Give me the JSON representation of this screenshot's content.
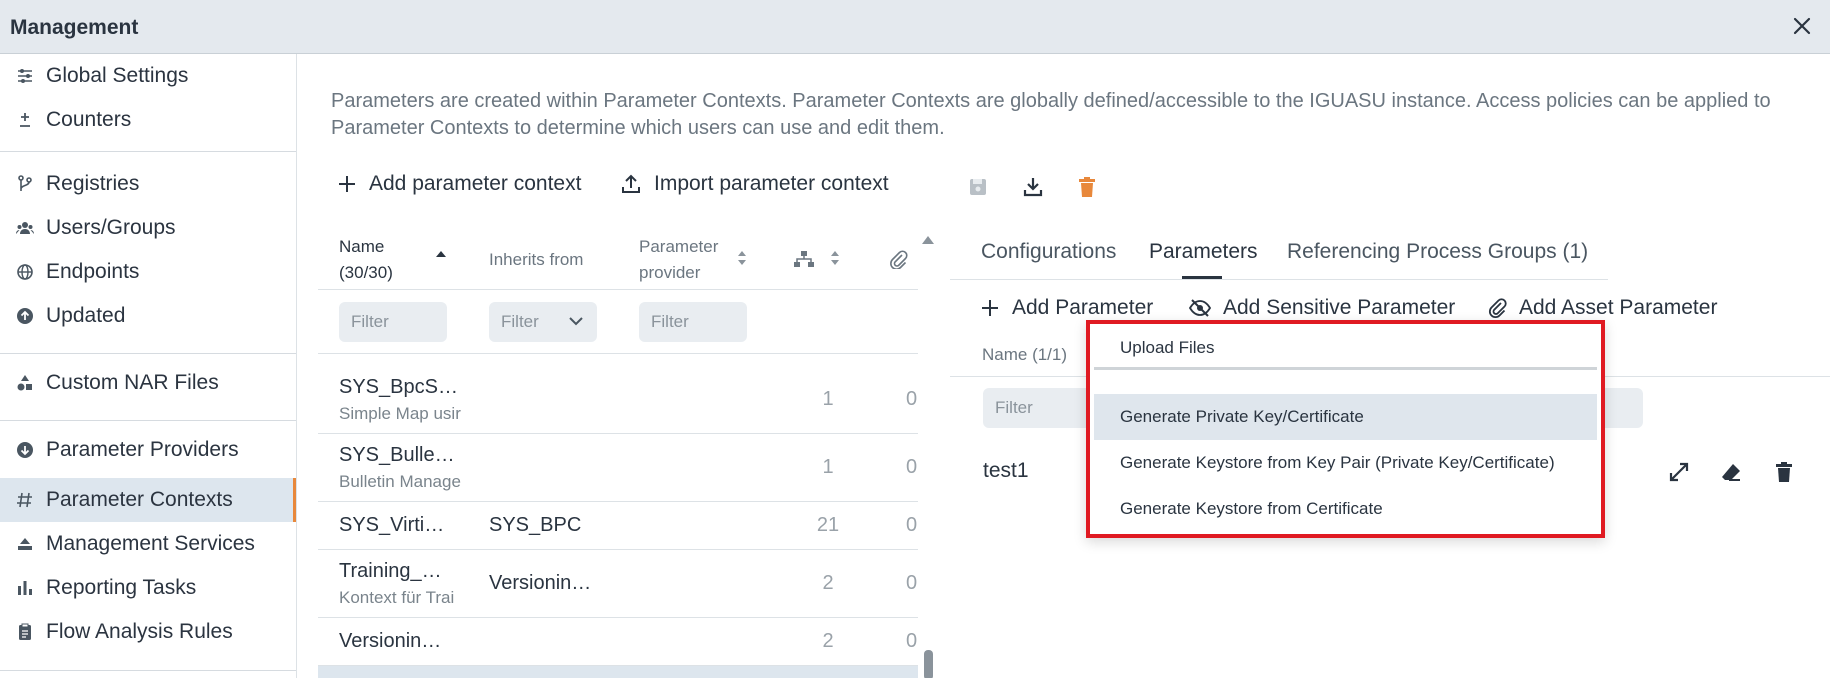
{
  "window": {
    "title": "Management"
  },
  "sidebar": {
    "items": [
      {
        "label": "Global Settings",
        "icon": "sliders-icon"
      },
      {
        "label": "Counters",
        "icon": "plus-minus-icon"
      },
      {
        "label": "Registries",
        "icon": "branch-icon"
      },
      {
        "label": "Users/Groups",
        "icon": "users-icon"
      },
      {
        "label": "Endpoints",
        "icon": "globe-icon"
      },
      {
        "label": "Updated",
        "icon": "arrow-up-circle-icon"
      },
      {
        "label": "Custom NAR Files",
        "icon": "shapes-icon"
      },
      {
        "label": "Parameter Providers",
        "icon": "arrow-down-circle-icon"
      },
      {
        "label": "Parameter Contexts",
        "icon": "hash-icon"
      },
      {
        "label": "Management Services",
        "icon": "stack-icon"
      },
      {
        "label": "Reporting Tasks",
        "icon": "bar-chart-icon"
      },
      {
        "label": "Flow Analysis Rules",
        "icon": "clipboard-icon"
      }
    ]
  },
  "main": {
    "description": "Parameters are created within Parameter Contexts. Parameter Contexts are globally defined/accessible to the IGUASU instance. Access policies can be applied to Parameter Contexts to determine which users can use and edit them.",
    "toolbar": {
      "add_label": "Add parameter context",
      "import_label": "Import parameter context"
    },
    "table": {
      "headers": {
        "name": "Name",
        "name_count": "(30/30)",
        "inherits": "Inherits from",
        "provider_1": "Parameter",
        "provider_2": "provider"
      },
      "filters": {
        "name": "Filter",
        "inherits": "Filter",
        "provider": "Filter"
      },
      "rows": [
        {
          "name": "SYS_BpcS…",
          "sub": "Simple Map usir",
          "inherits": "",
          "count": "1",
          "assets": "0"
        },
        {
          "name": "SYS_Bulle…",
          "sub": "Bulletin Manage",
          "inherits": "",
          "count": "1",
          "assets": "0"
        },
        {
          "name": "SYS_Virti…",
          "sub": "",
          "inherits": "SYS_BPC",
          "count": "21",
          "assets": "0"
        },
        {
          "name": "Training_…",
          "sub": "Kontext für Trai",
          "inherits": "Versionin…",
          "count": "2",
          "assets": "0"
        },
        {
          "name": "Versionin…",
          "sub": "",
          "inherits": "",
          "count": "2",
          "assets": "0"
        }
      ]
    }
  },
  "detail": {
    "tabs": [
      {
        "label": "Configurations"
      },
      {
        "label": "Parameters"
      },
      {
        "label": "Referencing Process Groups (1)"
      }
    ],
    "actions": {
      "add_param": "Add Parameter",
      "add_sensitive": "Add Sensitive Parameter",
      "add_asset": "Add Asset Parameter"
    },
    "list": {
      "header": "Name (1/1)",
      "filter": "Filter",
      "rows": [
        {
          "name": "test1"
        }
      ]
    }
  },
  "menu": {
    "items": [
      "Upload Files",
      "Generate Private Key/Certificate",
      "Generate Keystore from Key Pair (Private Key/Certificate)",
      "Generate Keystore from Certificate"
    ]
  },
  "colors": {
    "accent": "#e8883b",
    "highlight_border": "#e01a22",
    "sidebar_active": "#dde6ee"
  }
}
